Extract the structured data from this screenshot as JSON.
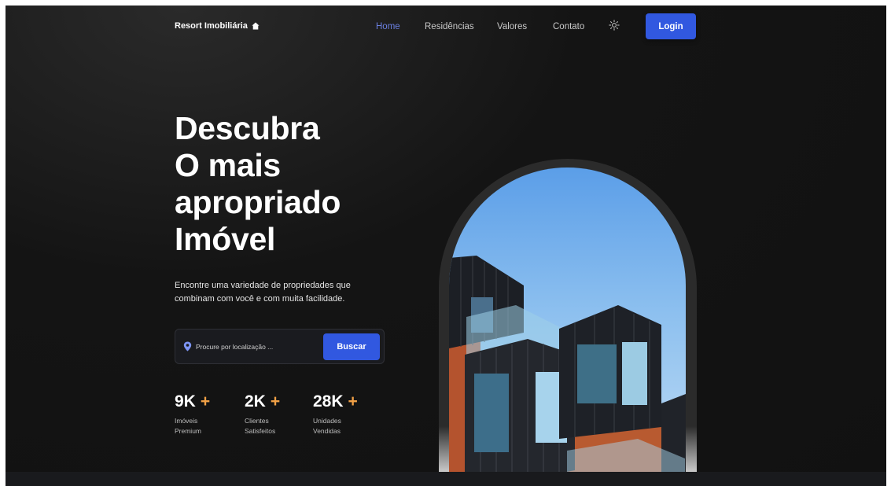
{
  "header": {
    "brand": "Resort Imobiliária",
    "brand_icon": "home-icon",
    "nav": [
      {
        "label": "Home",
        "active": true
      },
      {
        "label": "Residências",
        "active": false
      },
      {
        "label": "Valores",
        "active": false
      },
      {
        "label": "Contato",
        "active": false
      }
    ],
    "theme_icon": "sun-icon",
    "login_label": "Login"
  },
  "hero": {
    "title_lines": [
      "Descubra",
      "O mais",
      "apropriado",
      "Imóvel"
    ],
    "subtitle": "Encontre uma variedade de propriedades que combinam com você e com muita facilidade.",
    "search": {
      "placeholder": "Procure por localização ...",
      "button_label": "Buscar",
      "icon": "location-pin-icon"
    },
    "stats": [
      {
        "value": "9K",
        "plus": "+",
        "label": "Imóveis Premium"
      },
      {
        "value": "2K",
        "plus": "+",
        "label": "Clientes Satisfeitos"
      },
      {
        "value": "28K",
        "plus": "+",
        "label": "Unidades Vendidas"
      }
    ]
  },
  "colors": {
    "accent": "#3158e0",
    "active_nav": "#6b7fe0",
    "plus": "#f0a046",
    "background": "#111111"
  }
}
